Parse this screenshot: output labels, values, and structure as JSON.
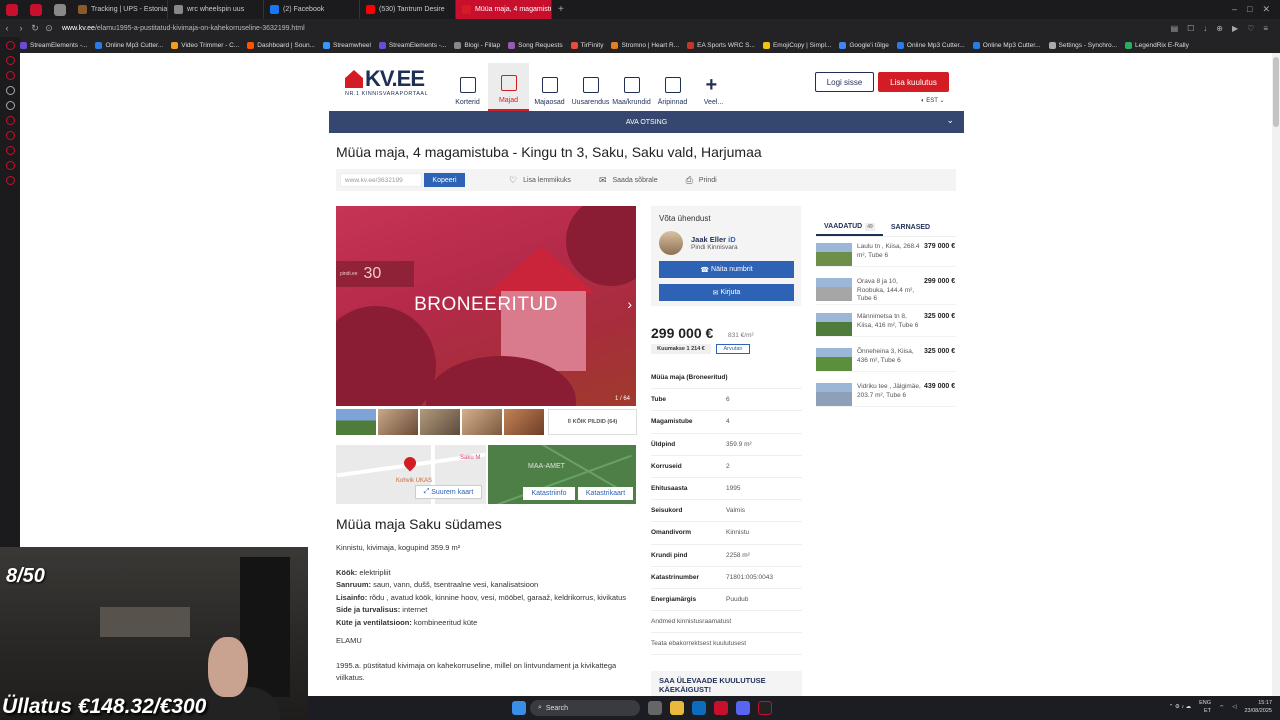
{
  "browser": {
    "tabs": [
      {
        "label": "",
        "color": "#c8102e"
      },
      {
        "label": "",
        "color": "#888888"
      },
      {
        "label": "Tracking | UPS - Estonia",
        "color": "#8b5a2b"
      },
      {
        "label": "wrc wheelspin uus",
        "color": "#888888"
      },
      {
        "label": "(2) Facebook",
        "color": "#1877f2"
      },
      {
        "label": "(530) Tantrum Desire",
        "color": "#ff0000"
      },
      {
        "label": "Müüa maja, 4 magamistuba",
        "color": "#d41c24"
      }
    ],
    "url_host": "www.kv.ee",
    "url_path": "/elamu1995-a-pustitatud-kivimaja-on-kahekorruseline-3632199.html",
    "bookmarks": [
      {
        "label": "StreamElements -...",
        "color": "#6c4bd6"
      },
      {
        "label": "Online Mp3 Cutter...",
        "color": "#2a7be4"
      },
      {
        "label": "Video Trimmer - C...",
        "color": "#f0a020"
      },
      {
        "label": "Dashboard | Soun...",
        "color": "#ff5500"
      },
      {
        "label": "Streamwheel",
        "color": "#3399ff"
      },
      {
        "label": "StreamElements -...",
        "color": "#6c4bd6"
      },
      {
        "label": "Blogi - Fillap",
        "color": "#888888"
      },
      {
        "label": "Song Requests",
        "color": "#9b59b6"
      },
      {
        "label": "TirFinity",
        "color": "#e74c3c"
      },
      {
        "label": "Stromno | Heart R...",
        "color": "#e67e22"
      },
      {
        "label": "EA Sports WRC S...",
        "color": "#c0392b"
      },
      {
        "label": "EmojiCopy | Simpl...",
        "color": "#f1c40f"
      },
      {
        "label": "Google'i tõlge",
        "color": "#4285f4"
      },
      {
        "label": "Online Mp3 Cutter...",
        "color": "#2a7be4"
      },
      {
        "label": "Online Mp3 Cutter...",
        "color": "#2a7be4"
      },
      {
        "label": "Settings - Synchro...",
        "color": "#aaaaaa"
      },
      {
        "label": "LegendRix E-Rally",
        "color": "#27ae60"
      }
    ]
  },
  "site": {
    "logo_text": "KV.EE",
    "logo_sub": "NR.1 KINNISVARAPORTAAL",
    "nav": [
      {
        "label": "Korterid",
        "active": false
      },
      {
        "label": "Majad",
        "active": true
      },
      {
        "label": "Majaosad",
        "active": false
      },
      {
        "label": "Uusarendus",
        "active": false
      },
      {
        "label": "Maa/krundid",
        "active": false
      },
      {
        "label": "Äripinnad",
        "active": false
      },
      {
        "label": "Veel...",
        "active": false
      }
    ],
    "login_label": "Logi sisse",
    "add_listing_label": "Lisa kuulutus",
    "language": "EST",
    "adv_search_label": "AVA OTSING",
    "brand_red": "#d41c24",
    "brand_navy": "#1f2f55",
    "accent_blue": "#2d62b5"
  },
  "listing": {
    "title": "Müüa maja, 4 magamistuba - Kingu tn 3, Saku, Saku vald, Harjumaa",
    "short_url": "www.kv.ee/3632199",
    "copy_label": "Kopeeri",
    "favorite_label": "Lisa lemmikuks",
    "send_label": "Saada sõbrale",
    "print_label": "Prindi",
    "overlay_label": "BRONEERITUD",
    "photo_counter": "1 / 64",
    "image_brand": "30",
    "image_brand_small": "pindi.ee",
    "all_pics_label": "KÕIK PILDID (64)",
    "map_label": "Suurem kaart",
    "map_place": "Saku M",
    "map_cafe": "Kohvik UKAS",
    "cadastre_info_label": "Katastriinfo",
    "cadastre_map_label": "Katastrikaart",
    "maaamet_label": "MAA-AMET",
    "heading": "Müüa maja Saku südames",
    "intro": "Kinnistu, kivimaja, kogupind 359.9 m²",
    "features": [
      {
        "k": "Köök:",
        "v": " elektripliit"
      },
      {
        "k": "Sanruum:",
        "v": " saun, vann, dušš, tsentraalne vesi, kanalisatsioon"
      },
      {
        "k": "Lisainfo:",
        "v": " rõdu , avatud köök, kinnine hoov, vesi, mööbel, garaaž, keldrikorrus, kivikatus"
      },
      {
        "k": "Side ja turvalisus:",
        "v": " internet"
      },
      {
        "k": "Küte ja ventilatsioon:",
        "v": " kombineeritud küte"
      }
    ],
    "type_label": "ELAMU",
    "body_text": "1995.a. püstitatud kivimaja on kahekorruseline, millel on lintvundament ja kivikattega viilkatus."
  },
  "contact": {
    "heading": "Võta ühendust",
    "agent_name": "Jaak Eller",
    "agent_company": "Pindi Kinnisvara",
    "phone_label": "Näita numbrit",
    "write_label": "Kirjuta"
  },
  "price": {
    "amount": "299 000 €",
    "per_sqm": "831 €/m²",
    "monthly": "Kuumakse 1 214 €",
    "calc_label": "Arvutan"
  },
  "specs": [
    {
      "k": "Müüa maja (Broneeritud)",
      "v": "",
      "full": true
    },
    {
      "k": "Tube",
      "v": "6"
    },
    {
      "k": "Magamistube",
      "v": "4"
    },
    {
      "k": "Üldpind",
      "v": "359.9 m²"
    },
    {
      "k": "Korruseid",
      "v": "2"
    },
    {
      "k": "Ehitusaasta",
      "v": "1995"
    },
    {
      "k": "Seisukord",
      "v": "Valmis"
    },
    {
      "k": "Omandivorm",
      "v": "Kinnistu"
    },
    {
      "k": "Krundi pind",
      "v": "2258 m²"
    },
    {
      "k": "Katastrinumber",
      "v": "71801:005:0043"
    },
    {
      "k": "Energiamärgis",
      "v": "Puudub"
    },
    {
      "k": "Andmed kinnistusraamatust",
      "v": "",
      "full": true,
      "link": true
    },
    {
      "k": "Teata ebakorrektsest kuulutusest",
      "v": "",
      "full": true,
      "link": true
    }
  ],
  "promo": "SAA ÜLEVAADE KUULUTUSE KÄEKÄIGUST!",
  "related": {
    "tab_viewed": "VAADATUD",
    "tab_viewed_count": "49",
    "tab_similar": "SARNASED",
    "items": [
      {
        "text": "Laulu tn , Kiisa, 268.4 m², Tube 6",
        "price": "379 000 €"
      },
      {
        "text": "Orava 8 ja 10, Roobuka, 144.4 m², Tube 6",
        "price": "299 000 €"
      },
      {
        "text": "Männimetsa tn 8, Kiisa, 416 m², Tube 6",
        "price": "325 000 €"
      },
      {
        "text": "Õnneheina 3, Kiisa, 436 m², Tube 6",
        "price": "325 000 €"
      },
      {
        "text": "Vidriku tee , Jälgimäe, 203.7 m², Tube 6",
        "price": "439 000 €"
      }
    ]
  },
  "webcam": {
    "counter": "8/50",
    "donation": "Üllatus €148.32/€300"
  },
  "taskbar": {
    "search_placeholder": "Search",
    "lang1": "ENG",
    "lang2": "ET",
    "time": "15:17",
    "date": "23/08/2025"
  }
}
